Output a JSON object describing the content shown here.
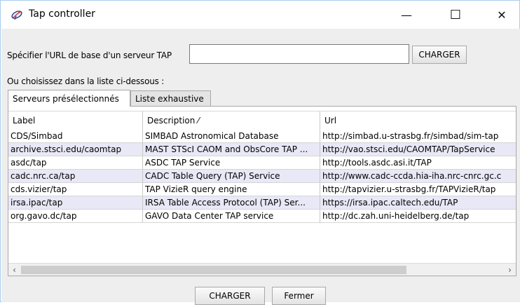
{
  "window": {
    "title": "Tap controller",
    "minimize_glyph": "—",
    "maximize_glyph": "☐",
    "close_glyph": "✕"
  },
  "url_section": {
    "label": "Spécifier l'URL de base d'un serveur TAP",
    "input_value": "",
    "input_placeholder": "",
    "load_button": "CHARGER"
  },
  "choose_label": "Ou choisissez dans la liste ci-dessous :",
  "tabs": [
    {
      "label": "Serveurs présélectionnés",
      "active": true
    },
    {
      "label": "Liste exhaustive",
      "active": false
    }
  ],
  "table": {
    "columns": [
      "Label",
      "Description  ⁄",
      "Url"
    ],
    "rows": [
      {
        "label": "CDS/Simbad",
        "description": "SIMBAD Astronomical Database",
        "url": "http://simbad.u-strasbg.fr/simbad/sim-tap"
      },
      {
        "label": "archive.stsci.edu/caomtap",
        "description": "MAST STScI CAOM and ObsCore TAP ...",
        "url": "http://vao.stsci.edu/CAOMTAP/TapService"
      },
      {
        "label": "asdc/tap",
        "description": "ASDC TAP Service",
        "url": "http://tools.asdc.asi.it/TAP"
      },
      {
        "label": "cadc.nrc.ca/tap",
        "description": "CADC Table Query (TAP) Service",
        "url": "http://www.cadc-ccda.hia-iha.nrc-cnrc.gc.c"
      },
      {
        "label": "cds.vizier/tap",
        "description": "TAP VizieR query engine",
        "url": "http://tapvizier.u-strasbg.fr/TAPVizieR/tap"
      },
      {
        "label": "irsa.ipac/tap",
        "description": "IRSA Table Access Protocol (TAP) Ser...",
        "url": "https://irsa.ipac.caltech.edu/TAP"
      },
      {
        "label": "org.gavo.dc/tap",
        "description": "GAVO Data Center TAP service",
        "url": "http://dc.zah.uni-heidelberg.de/tap"
      }
    ],
    "scroll_left_glyph": "‹",
    "scroll_right_glyph": "›"
  },
  "footer": {
    "load_button": "CHARGER",
    "close_button": "Fermer"
  }
}
